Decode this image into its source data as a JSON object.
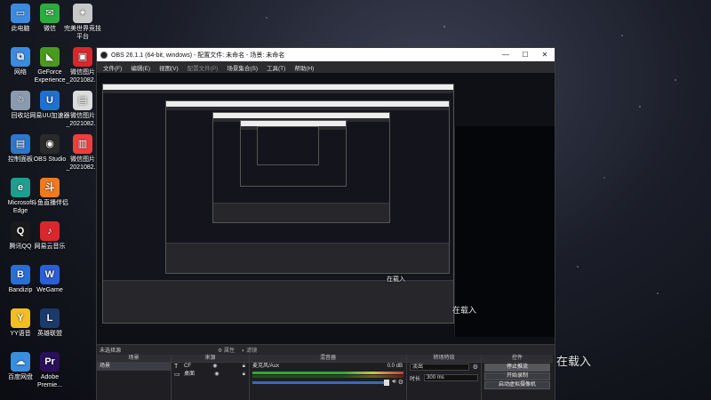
{
  "desktop": {
    "icons_col1": [
      {
        "label": "此电脑",
        "color": "#3c8be0",
        "glyph": "▭"
      },
      {
        "label": "网络",
        "color": "#3c8be0",
        "glyph": "⧉"
      },
      {
        "label": "回收站",
        "color": "#8a9bb0",
        "glyph": "♲"
      },
      {
        "label": "控制面板",
        "color": "#2f77c9",
        "glyph": "▤"
      },
      {
        "label": "Microsoft Edge",
        "color": "#1e9e8e",
        "glyph": "e"
      },
      {
        "label": "腾讯QQ",
        "color": "#1a1a1a",
        "glyph": "Q"
      },
      {
        "label": "Bandizip",
        "color": "#2a6fd6",
        "glyph": "B"
      },
      {
        "label": "YY语音",
        "color": "#f0c020",
        "glyph": "Y"
      },
      {
        "label": "百度网盘",
        "color": "#3b8de0",
        "glyph": "☁"
      }
    ],
    "icons_col2": [
      {
        "label": "微信",
        "color": "#2aae3f",
        "glyph": "✉"
      },
      {
        "label": "GeForce Experience",
        "color": "#4a9a1e",
        "glyph": "◣"
      },
      {
        "label": "网易UU加速器",
        "color": "#2070d0",
        "glyph": "U"
      },
      {
        "label": "OBS Studio",
        "color": "#2a2a2a",
        "glyph": "◉"
      },
      {
        "label": "斗鱼直播伴侣",
        "color": "#f07a20",
        "glyph": "斗"
      },
      {
        "label": "网易云音乐",
        "color": "#d8282e",
        "glyph": "♪"
      },
      {
        "label": "WeGame",
        "color": "#2a5fd8",
        "glyph": "W"
      },
      {
        "label": "英雄联盟",
        "color": "#1b3a6b",
        "glyph": "L"
      },
      {
        "label": "Adobe Premie...",
        "color": "#2a0f5a",
        "glyph": "Pr"
      }
    ],
    "icons_col3": [
      {
        "label": "完美世界竞技平台",
        "color": "#c8c8c8",
        "glyph": "✦"
      },
      {
        "label": "微信图片_2021082...",
        "color": "#d8282e",
        "glyph": "▣"
      },
      {
        "label": "微信图片_2021082...",
        "color": "#dcdcdc",
        "glyph": "▤"
      },
      {
        "label": "微信图片_2021082...",
        "color": "#ef3e3e",
        "glyph": "▥"
      }
    ]
  },
  "obs": {
    "title": "OBS 26.1.1 (64-bit, windows) - 配置文件: 未命名 - 场景: 未命名",
    "window_buttons": {
      "minimize": "—",
      "maximize": "☐",
      "close": "✕"
    },
    "menu": [
      "文件(F)",
      "编辑(E)",
      "视图(V)",
      "配置文件(P)",
      "场景集合(S)",
      "工具(T)",
      "帮助(H)"
    ],
    "no_source_selected": "未选择源",
    "properties_label": "属性",
    "filters_label": "滤镜",
    "docks": {
      "scenes": {
        "header": "场景",
        "items": [
          "场景"
        ]
      },
      "sources": {
        "header": "来源",
        "items": [
          {
            "icon": "T",
            "name": "CF"
          },
          {
            "icon": "▭",
            "name": "桌面"
          }
        ]
      },
      "mixer": {
        "header": "混音器",
        "track": "麦克风/Aux",
        "db": "0.0 dB"
      },
      "transitions": {
        "header": "转场特效",
        "type": "淡出",
        "duration_label": "时长",
        "duration": "300 ms"
      },
      "controls": {
        "header": "控件",
        "buttons": [
          "停止推流",
          "开始录制",
          "启动虚拟摄像机"
        ]
      }
    }
  },
  "overlay": {
    "loading_text_1": "在载入",
    "loading_text_2": "在载入",
    "loading_text_3": "在载入"
  }
}
